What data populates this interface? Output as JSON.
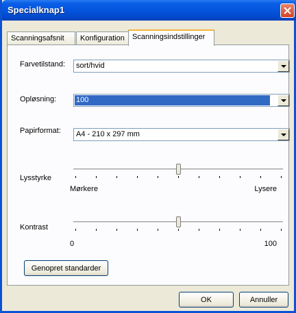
{
  "window": {
    "title": "Specialknap1"
  },
  "tabs": [
    {
      "label": "Scanningsafsnit"
    },
    {
      "label": "Konfiguration"
    },
    {
      "label": "Scanningsindstillinger"
    }
  ],
  "fields": {
    "color_mode": {
      "label": "Farvetilstand:",
      "value": "sort/hvid"
    },
    "resolution": {
      "label": "Opløsning:",
      "value": "100"
    },
    "paper_size": {
      "label": "Papirformat:",
      "value": "A4 - 210 x 297 mm"
    }
  },
  "brightness": {
    "label": "Lysstyrke",
    "min_label": "Mørkere",
    "max_label": "Lysere",
    "level": 0.5
  },
  "contrast": {
    "label": "Kontrast",
    "min_label": "0",
    "max_label": "100",
    "level": 0.5
  },
  "buttons": {
    "restore_defaults": "Genopret standarder",
    "ok": "OK",
    "cancel": "Annuller"
  },
  "colors": {
    "titlebar": "#0453dc",
    "selection": "#316ac5",
    "active_tab_accent": "#f7b43c"
  }
}
